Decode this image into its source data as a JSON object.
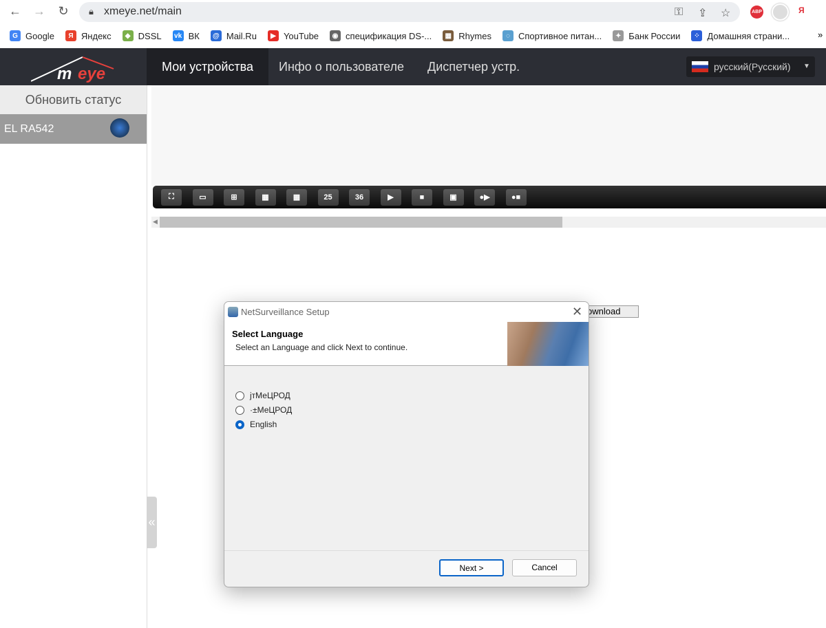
{
  "browser": {
    "url": "xmeye.net/main",
    "bookmarks": [
      {
        "label": "Google",
        "color": "#4285f4",
        "glyph": "G"
      },
      {
        "label": "Яндекс",
        "color": "#e8412c",
        "glyph": "Я"
      },
      {
        "label": "DSSL",
        "color": "#7bb04a",
        "glyph": "◆"
      },
      {
        "label": "ВК",
        "color": "#2787f5",
        "glyph": "vk"
      },
      {
        "label": "Mail.Ru",
        "color": "#2a6bd8",
        "glyph": "@"
      },
      {
        "label": "YouTube",
        "color": "#e52d27",
        "glyph": "▶"
      },
      {
        "label": "спецификация DS-...",
        "color": "#666",
        "glyph": "◉"
      },
      {
        "label": "Rhymes",
        "color": "#7a5c3c",
        "glyph": "▦"
      },
      {
        "label": "Спортивное питан...",
        "color": "#5aa0d0",
        "glyph": "◌"
      },
      {
        "label": "Банк России",
        "color": "#999",
        "glyph": "✦"
      },
      {
        "label": "Домашняя страни...",
        "color": "#2b5fd9",
        "glyph": "⁘"
      }
    ],
    "more": "»"
  },
  "app": {
    "logo_text": "MYeye",
    "accent": "#e8413c",
    "nav": [
      "Мои устройства",
      "Инфо о пользователе",
      "Диспетчер устр."
    ],
    "language": "русский(Русский)"
  },
  "sidebar": {
    "refresh_label": "Обновить статус",
    "device_name": "EL RA542",
    "collapse": "«"
  },
  "video_toolbar": {
    "buttons": [
      "fullscreen",
      "1-split",
      "4-split",
      "9-split",
      "16-split",
      "25",
      "36",
      "start-all-preview",
      "stop-all-preview",
      "snapshot",
      "start-record",
      "stop-record"
    ]
  },
  "download_label": "ownload",
  "dialog": {
    "title": "NetSurveillance Setup",
    "heading": "Select Language",
    "subheading": "Select an Language and click Next to continue.",
    "options": [
      {
        "label": "јтМеЦРОД",
        "selected": false
      },
      {
        "label": "·±МеЦРОД",
        "selected": false
      },
      {
        "label": "English",
        "selected": true
      }
    ],
    "next_label": "Next >",
    "cancel_label": "Cancel"
  }
}
